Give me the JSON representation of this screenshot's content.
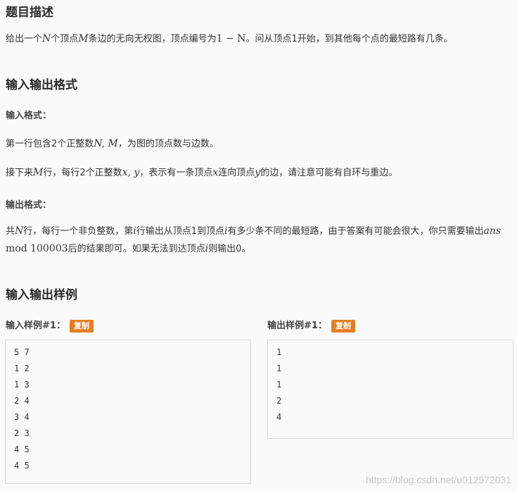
{
  "section1": {
    "title": "题目描述",
    "desc": {
      "t1": "给出一个",
      "N": "N",
      "t2": "个顶点",
      "M": "M",
      "t3": "条边的无向无权图，顶点编号为",
      "range": "1 − N",
      "t4": "。问从顶点1开始，到其他每个点的最短路有几条。"
    }
  },
  "section2": {
    "title": "输入输出格式",
    "input_label": "输入格式：",
    "line1": {
      "t1": "第一行包含2个正整数",
      "vars": "N, M",
      "t2": "，为图的顶点数与边数。"
    },
    "line2": {
      "t1": "接下来",
      "M": "M",
      "t2": "行，每行2个正整数",
      "vars": "x, y",
      "t3": "，表示有一条顶点",
      "x": "x",
      "t4": "连向顶点",
      "y": "y",
      "t5": "的边，请注意可能有自环与重边。"
    },
    "output_label": "输出格式：",
    "line3": {
      "t1": "共",
      "N": "N",
      "t2": "行，每行一个非负整数，第",
      "i": "i",
      "t3": "行输出从顶点1到顶点",
      "i2": "i",
      "t4": "有多少条不同的最短路，由于答案有可能会很大，你只需要输出",
      "ans": "ans",
      "mod": " mod 100003",
      "t5": "后的结果即可。如果无法到达顶点",
      "i3": "i",
      "t6": "则输出0。"
    }
  },
  "section3": {
    "title": "输入输出样例",
    "input_sample_label": "输入样例#1：",
    "output_sample_label": "输出样例#1：",
    "copy_label": "复制",
    "input_lines": [
      "5 7",
      "1 2",
      "1 3",
      "2 4",
      "3 4",
      "2 3",
      "4 5",
      "4 5"
    ],
    "output_lines": [
      "1",
      "1",
      "1",
      "2",
      "4"
    ]
  },
  "watermark": "https://blog.csdn.net/u012972031"
}
